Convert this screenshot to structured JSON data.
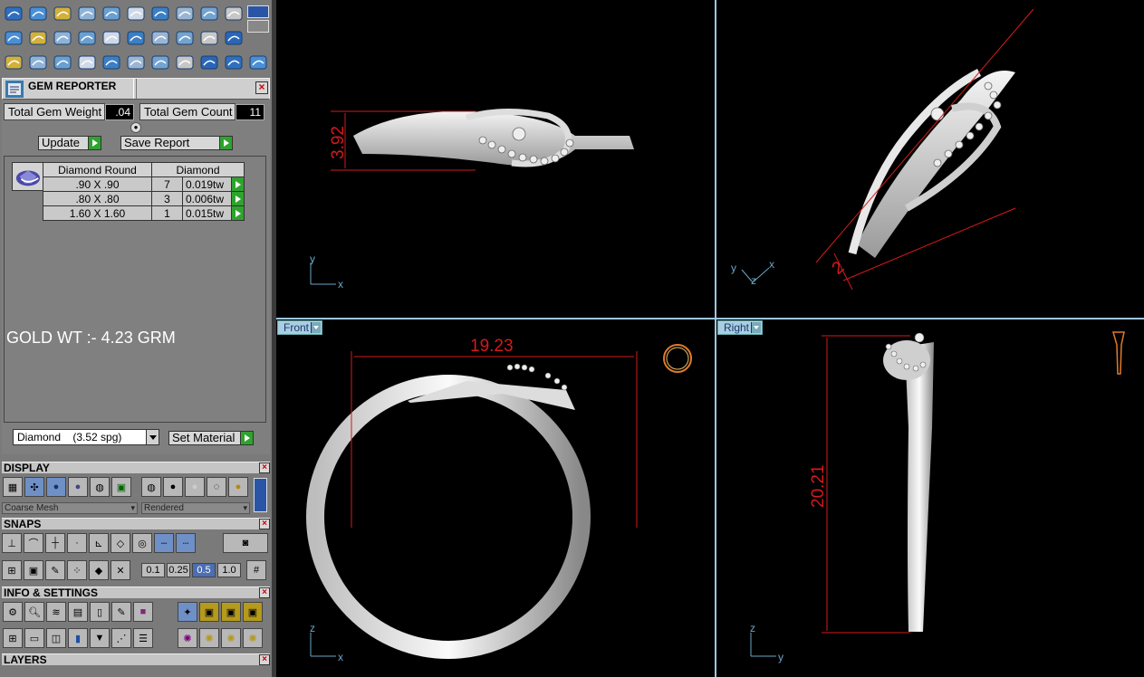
{
  "toolbar": {
    "rows": [
      [
        "curve-icon",
        "helix-icon",
        "gem-lock-icon",
        "gem-lock2-icon",
        "gem-lock3-icon",
        "pave-icon",
        "balloon-icon",
        "gear-icon",
        "spray-icon",
        "radial-icon"
      ],
      [
        "plane-icon",
        "diamond-icon",
        "slab-icon",
        "ribbon-icon",
        "doc-icon",
        "knife-icon",
        "sphere-cut-icon",
        "ring-dots-icon",
        "grid-icon",
        "node-icon"
      ],
      [
        "cubes-icon",
        "arc-icon",
        "bend-icon",
        "mirror-icon",
        "move-icon",
        "bevel-icon",
        "spark-icon",
        "link-icon",
        "align-icon",
        "scissors-icon",
        "circle-icon"
      ]
    ]
  },
  "gem_reporter": {
    "title": "GEM REPORTER",
    "total_weight_label": "Total Gem Weight",
    "total_weight_value": ".04",
    "total_count_label": "Total Gem Count",
    "total_count_value": "11",
    "update_label": "Update",
    "save_label": "Save Report",
    "table": {
      "headers": [
        "Diamond Round",
        "Diamond"
      ],
      "rows": [
        {
          "size": ".90 X .90",
          "count": "7",
          "wt": "0.019tw"
        },
        {
          "size": ".80 X .80",
          "count": "3",
          "wt": "0.006tw"
        },
        {
          "size": "1.60 X 1.60",
          "count": "1",
          "wt": "0.015tw"
        }
      ]
    },
    "note": "GOLD WT :- 4.23 GRM",
    "material": "Diamond    (3.52 spg)",
    "set_material_label": "Set Material"
  },
  "display": {
    "title": "DISPLAY",
    "mesh_mode": "Coarse Mesh",
    "render_mode": "Rendered"
  },
  "snaps": {
    "title": "SNAPS",
    "steps": [
      "0.1",
      "0.25",
      "0.5",
      "1.0"
    ],
    "active_step": "0.5"
  },
  "info": {
    "title": "INFO & SETTINGS"
  },
  "layers": {
    "title": "LAYERS"
  },
  "viewports": {
    "top_left": {
      "dim": "3.92",
      "axis_v": "y",
      "axis_h": "x"
    },
    "top_right": {
      "dim": "2",
      "axis_1": "y",
      "axis_2": "z",
      "axis_3": "x"
    },
    "front": {
      "tag": "Front",
      "dim": "19.23",
      "axis_v": "z",
      "axis_h": "x"
    },
    "right": {
      "tag": "Right",
      "dim": "20.21",
      "axis_v": "z",
      "axis_h": "y"
    }
  },
  "colors": {
    "accent": "#9ec6de",
    "dimension": "#d41a1a",
    "go_button": "#2ea32e"
  }
}
